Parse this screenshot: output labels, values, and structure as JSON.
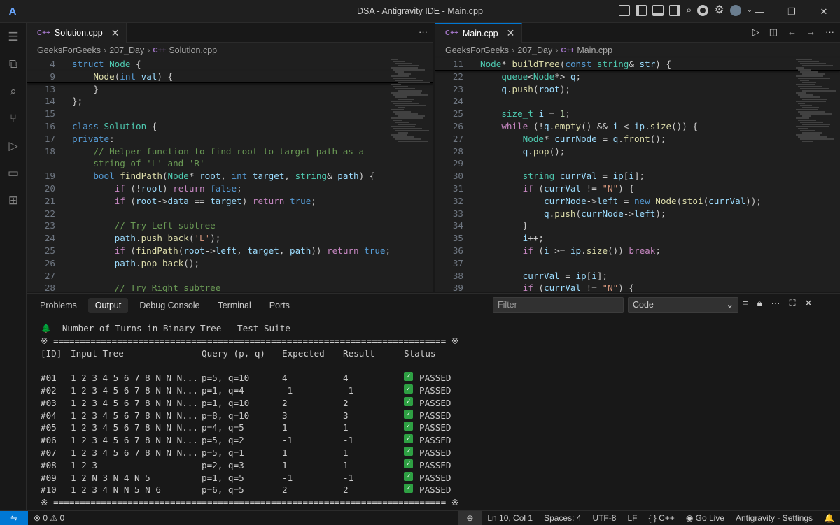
{
  "window": {
    "title": "DSA - Antigravity IDE - Main.cpp",
    "logo": "A",
    "title_icons": [
      "layout-toggle-icon",
      "panel-left-icon",
      "panel-bottom-icon",
      "panel-right-icon",
      "search-icon",
      "chrome-icon",
      "gear-icon",
      "avatar-icon"
    ],
    "controls": {
      "minimize": "—",
      "restore": "❐",
      "close": "✕"
    }
  },
  "activity_bar": [
    "menu-icon",
    "explorer-icon",
    "search-icon",
    "source-control-icon",
    "run-debug-icon",
    "remote-explorer-icon",
    "extensions-icon"
  ],
  "left_editor": {
    "tab": {
      "label": "Solution.cpp",
      "lang": "C++"
    },
    "more": "···",
    "breadcrumb": [
      "GeeksForGeeks",
      "207_Day",
      "Solution.cpp"
    ],
    "lines": [
      {
        "n": "4",
        "html": "<span class='kw'>struct</span> <span class='ty'>Node</span> {",
        "sticky": true
      },
      {
        "n": "9",
        "html": "    <span class='fn'>Node</span>(<span class='kw'>int</span> <span class='va'>val</span>) {",
        "sticky": true
      },
      {
        "n": "13",
        "html": "    }"
      },
      {
        "n": "14",
        "html": "};"
      },
      {
        "n": "15",
        "html": ""
      },
      {
        "n": "16",
        "html": "<span class='kw'>class</span> <span class='ty'>Solution</span> {"
      },
      {
        "n": "17",
        "html": "<span class='kw'>private</span>:"
      },
      {
        "n": "18",
        "html": "    <span class='cm'>// Helper function to find root-to-target path as a</span>"
      },
      {
        "n": "",
        "html": "    <span class='cm'>string of 'L' and 'R'</span>"
      },
      {
        "n": "19",
        "html": "    <span class='kw'>bool</span> <span class='fn'>findPath</span>(<span class='ty'>Node</span>* <span class='va'>root</span>, <span class='kw'>int</span> <span class='va'>target</span>, <span class='ty'>string</span>&amp; <span class='va'>path</span>) {"
      },
      {
        "n": "20",
        "html": "        <span class='ct'>if</span> (!<span class='va'>root</span>) <span class='ct'>return</span> <span class='kw'>false</span>;"
      },
      {
        "n": "21",
        "html": "        <span class='ct'>if</span> (<span class='va'>root</span>-&gt;<span class='va'>data</span> == <span class='va'>target</span>) <span class='ct'>return</span> <span class='kw'>true</span>;"
      },
      {
        "n": "22",
        "html": ""
      },
      {
        "n": "23",
        "html": "        <span class='cm'>// Try Left subtree</span>"
      },
      {
        "n": "24",
        "html": "        <span class='va'>path</span>.<span class='fn'>push_back</span>(<span class='st'>'L'</span>);"
      },
      {
        "n": "25",
        "html": "        <span class='ct'>if</span> (<span class='fn'>findPath</span>(<span class='va'>root</span>-&gt;<span class='va'>left</span>, <span class='va'>target</span>, <span class='va'>path</span>)) <span class='ct'>return</span> <span class='kw'>true</span>;"
      },
      {
        "n": "26",
        "html": "        <span class='va'>path</span>.<span class='fn'>pop_back</span>();"
      },
      {
        "n": "27",
        "html": ""
      },
      {
        "n": "28",
        "html": "        <span class='cm'>// Try Right subtree</span>"
      }
    ]
  },
  "right_editor": {
    "tab": {
      "label": "Main.cpp",
      "lang": "C++"
    },
    "actions": [
      "▷",
      "◫",
      "←",
      "→",
      "···"
    ],
    "breadcrumb": [
      "GeeksForGeeks",
      "207_Day",
      "Main.cpp"
    ],
    "lines": [
      {
        "n": "11",
        "html": "<span class='ty'>Node</span>* <span class='fn'>buildTree</span>(<span class='kw'>const</span> <span class='ty'>string</span>&amp; <span class='va'>str</span>) {",
        "sticky": true
      },
      {
        "n": "22",
        "html": "    <span class='ty'>queue</span>&lt;<span class='ty'>Node</span>*&gt; <span class='va'>q</span>;"
      },
      {
        "n": "23",
        "html": "    <span class='va'>q</span>.<span class='fn'>push</span>(<span class='va'>root</span>);"
      },
      {
        "n": "24",
        "html": ""
      },
      {
        "n": "25",
        "html": "    <span class='ty'>size_t</span> <span class='va'>i</span> = <span class='nm'>1</span>;"
      },
      {
        "n": "26",
        "html": "    <span class='ct'>while</span> (!<span class='va'>q</span>.<span class='fn'>empty</span>() &amp;&amp; <span class='va'>i</span> &lt; <span class='va'>ip</span>.<span class='fn'>size</span>()) {"
      },
      {
        "n": "27",
        "html": "        <span class='ty'>Node</span>* <span class='va'>currNode</span> = <span class='va'>q</span>.<span class='fn'>front</span>();"
      },
      {
        "n": "28",
        "html": "        <span class='va'>q</span>.<span class='fn'>pop</span>();"
      },
      {
        "n": "29",
        "html": ""
      },
      {
        "n": "30",
        "html": "        <span class='ty'>string</span> <span class='va'>currVal</span> = <span class='va'>ip</span>[<span class='va'>i</span>];"
      },
      {
        "n": "31",
        "html": "        <span class='ct'>if</span> (<span class='va'>currVal</span> != <span class='st'>\"N\"</span>) {"
      },
      {
        "n": "32",
        "html": "            <span class='va'>currNode</span>-&gt;<span class='va'>left</span> = <span class='kw'>new</span> <span class='fn'>Node</span>(<span class='fn'>stoi</span>(<span class='va'>currVal</span>));"
      },
      {
        "n": "33",
        "html": "            <span class='va'>q</span>.<span class='fn'>push</span>(<span class='va'>currNode</span>-&gt;<span class='va'>left</span>);"
      },
      {
        "n": "34",
        "html": "        }"
      },
      {
        "n": "35",
        "html": "        <span class='va'>i</span>++;"
      },
      {
        "n": "36",
        "html": "        <span class='ct'>if</span> (<span class='va'>i</span> &gt;= <span class='va'>ip</span>.<span class='fn'>size</span>()) <span class='ct'>break</span>;"
      },
      {
        "n": "37",
        "html": ""
      },
      {
        "n": "38",
        "html": "        <span class='va'>currVal</span> = <span class='va'>ip</span>[<span class='va'>i</span>];"
      },
      {
        "n": "39",
        "html": "        <span class='ct'>if</span> (<span class='va'>currVal</span> != <span class='st'>\"N\"</span>) {"
      }
    ]
  },
  "panel": {
    "tabs": [
      "Problems",
      "Output",
      "Debug Console",
      "Terminal",
      "Ports"
    ],
    "active_tab": "Output",
    "filter_placeholder": "Filter",
    "channel": "Code",
    "icons": [
      "clear-output-icon",
      "lock-icon",
      "more-icon",
      "maximize-icon",
      "close-icon"
    ],
    "output": {
      "heading": "🌲  Number of Turns in Binary Tree — Test Suite",
      "rule": "※ ========================================================================== ※",
      "columns": [
        "[ID]",
        "Input Tree",
        "Query (p, q)",
        "Expected",
        "Result",
        "Status"
      ],
      "dash": "----------------------------------------------------------------------------",
      "rows": [
        [
          "#01",
          "1 2 3 4 5 6 7 8 N N N...",
          "p=5, q=10",
          "4",
          "4",
          "PASSED"
        ],
        [
          "#02",
          "1 2 3 4 5 6 7 8 N N N...",
          "p=1, q=4",
          "-1",
          "-1",
          "PASSED"
        ],
        [
          "#03",
          "1 2 3 4 5 6 7 8 N N N...",
          "p=1, q=10",
          "2",
          "2",
          "PASSED"
        ],
        [
          "#04",
          "1 2 3 4 5 6 7 8 N N N...",
          "p=8, q=10",
          "3",
          "3",
          "PASSED"
        ],
        [
          "#05",
          "1 2 3 4 5 6 7 8 N N N...",
          "p=4, q=5",
          "1",
          "1",
          "PASSED"
        ],
        [
          "#06",
          "1 2 3 4 5 6 7 8 N N N...",
          "p=5, q=2",
          "-1",
          "-1",
          "PASSED"
        ],
        [
          "#07",
          "1 2 3 4 5 6 7 8 N N N...",
          "p=5, q=1",
          "1",
          "1",
          "PASSED"
        ],
        [
          "#08",
          "1 2 3",
          "p=2, q=3",
          "1",
          "1",
          "PASSED"
        ],
        [
          "#09",
          "1 2 N 3 N 4 N 5",
          "p=1, q=5",
          "-1",
          "-1",
          "PASSED"
        ],
        [
          "#10",
          "1 2 3 4 N N 5 N 6",
          "p=6, q=5",
          "2",
          "2",
          "PASSED"
        ]
      ]
    }
  },
  "status_bar": {
    "remote": "⇋",
    "problems": "⊗ 0  ⚠ 0",
    "zoom": "⊕",
    "position": "Ln 10, Col 1",
    "spaces": "Spaces: 4",
    "encoding": "UTF-8",
    "eol": "LF",
    "language": "{ } C++",
    "golive": "Go Live",
    "settings": "Antigravity - Settings",
    "bell": "🔔"
  }
}
